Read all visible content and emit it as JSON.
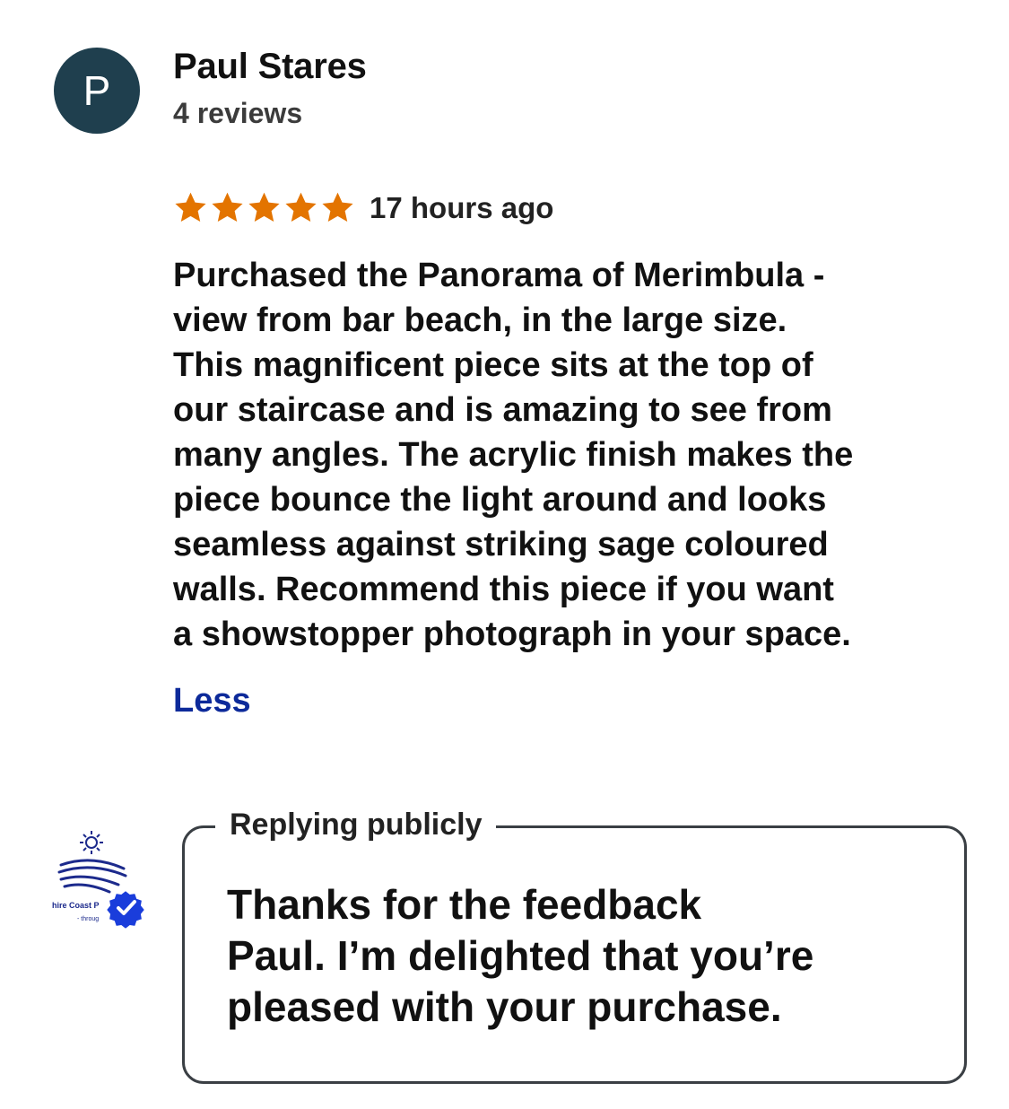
{
  "reviewer": {
    "initial": "P",
    "name": "Paul Stares",
    "review_count": "4 reviews"
  },
  "review": {
    "rating": 5,
    "max_rating": 5,
    "star_color": "#e37400",
    "time_ago": "17 hours ago",
    "text": "Purchased the Panorama of Merimbula -\nview from bar beach, in the large size.\nThis magnificent piece sits at the top of\nour staircase and is amazing to see from\nmany angles.  The acrylic finish makes the\npiece bounce the light around and looks\nseamless against striking sage coloured\nwalls.  Recommend this piece if you want\na showstopper photograph in your space.",
    "toggle_label": "Less"
  },
  "reply": {
    "legend": "Replying publicly",
    "text": "Thanks for the feedback\nPaul. I’m delighted that you’re\npleased with your purchase.",
    "owner_logo_text": "hire Coast P",
    "owner_logo_subtext": "- throug",
    "verified_color": "#1a3ddb"
  },
  "colors": {
    "avatar_bg": "#1f3f4e",
    "link": "#0d2a9a",
    "logo_navy": "#1c2a8c"
  }
}
